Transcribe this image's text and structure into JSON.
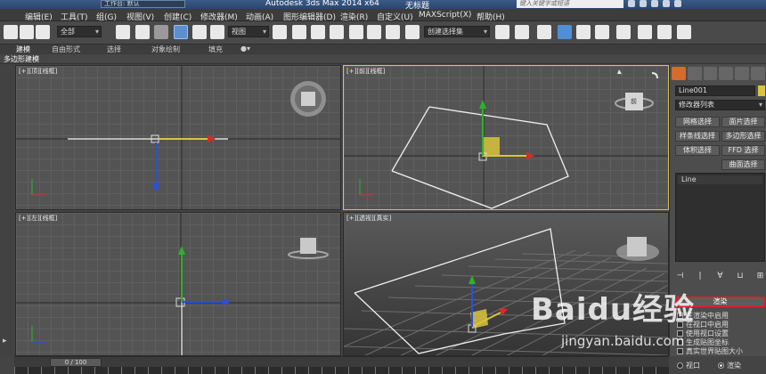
{
  "window": {
    "title": "Autodesk 3ds Max  2014 x64",
    "subtitle": "无标题",
    "workspace": "工作台: 默认",
    "search_placeholder": "键入关键字或短语"
  },
  "menu": [
    "编辑(E)",
    "工具(T)",
    "组(G)",
    "视图(V)",
    "创建(C)",
    "修改器(M)",
    "动画(A)",
    "图形编辑器(D)",
    "渲染(R)",
    "自定义(U)",
    "MAXScript(X)",
    "帮助(H)"
  ],
  "toolbar": {
    "selection_filter": "全部",
    "reference_coord": "视图",
    "named_selection": "创建选择集"
  },
  "ribbon": {
    "tabs": [
      "建模",
      "自由形式",
      "选择",
      "对象绘制",
      "填充"
    ],
    "active": "建模",
    "sub_label": "多边形建模"
  },
  "viewports": {
    "top_left": "[+][顶][线框]",
    "top_right": "[+][前][线框]",
    "bottom_left": "[+][左][线框]",
    "bottom_right": "[+][透视][真实]",
    "viewcube_top": "前"
  },
  "command_panel": {
    "object_name": "Line001",
    "object_color": "#d9c43d",
    "modifier_list": "修改器列表",
    "buttons": [
      "网格选择",
      "面片选择",
      "样条线选择",
      "多边形选择",
      "体积选择",
      "FFD 选择",
      "曲面选择"
    ],
    "stack_item": "Line",
    "rollout_title": "渲染",
    "options": [
      {
        "label": "在渲染中启用",
        "checked": false
      },
      {
        "label": "在视口中启用",
        "checked": false
      },
      {
        "label": "使用视口设置",
        "checked": false
      },
      {
        "label": "生成贴图坐标",
        "checked": false
      },
      {
        "label": "真实世界贴图大小",
        "checked": false
      }
    ],
    "radio_viewport": "视口",
    "radio_render": "渲染"
  },
  "timeline": {
    "frame": "0 / 100"
  },
  "watermark": {
    "logo": "Baidu经验",
    "url": "jingyan.baidu.com"
  }
}
